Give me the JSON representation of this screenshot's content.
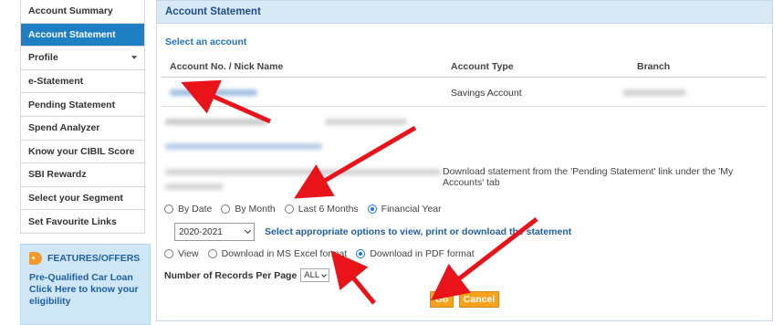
{
  "sidebar": {
    "items": [
      {
        "label": "Account Summary"
      },
      {
        "label": "Account Statement",
        "active": true
      },
      {
        "label": "Profile",
        "has_caret": true
      },
      {
        "label": "e-Statement"
      },
      {
        "label": "Pending Statement"
      },
      {
        "label": "Spend Analyzer"
      },
      {
        "label": "Know your CIBIL Score"
      },
      {
        "label": "SBI Rewardz"
      },
      {
        "label": "Select your Segment"
      },
      {
        "label": "Set Favourite Links"
      }
    ],
    "features": {
      "title": "FEATURES/OFFERS",
      "text": "Pre-Qualified Car Loan Click Here to know your eligibility",
      "icon": "tag-icon"
    }
  },
  "panel": {
    "title": "Account Statement",
    "select_account": "Select an account",
    "table": {
      "headers": [
        "Account No. / Nick Name",
        "Account Type",
        "Branch"
      ],
      "row": {
        "account_type": "Savings Account"
      }
    },
    "info_text": "Download statement from the 'Pending Statement' link under the 'My Accounts' tab",
    "period_options": [
      {
        "label": "By Date",
        "checked": false
      },
      {
        "label": "By Month",
        "checked": false
      },
      {
        "label": "Last 6 Months",
        "checked": false
      },
      {
        "label": "Financial Year",
        "checked": true
      }
    ],
    "year_select": {
      "value": "2020-2021"
    },
    "hint": "Select appropriate options to view, print or download the statement",
    "format_options": [
      {
        "label": "View",
        "checked": false
      },
      {
        "label": "Download in MS Excel format",
        "checked": false
      },
      {
        "label": "Download in PDF format",
        "checked": true
      }
    ],
    "records_label": "Number of Records Per Page",
    "records_value": "ALL",
    "go_label": "Go",
    "cancel_label": "Cancel"
  },
  "colors": {
    "active_tab": "#1e7fc2",
    "header_bg": "#d9e8f5",
    "button": "#f7a21b",
    "arrow": "#e8141a"
  }
}
